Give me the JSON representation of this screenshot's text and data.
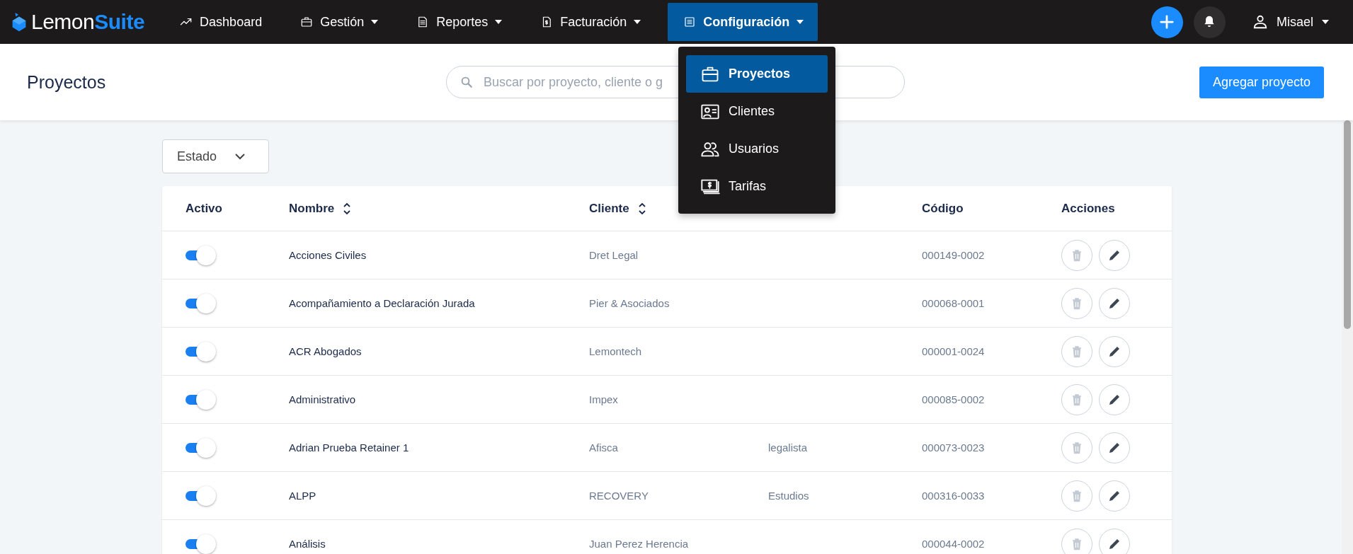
{
  "navbar": {
    "logo": {
      "first": "Lemon",
      "second": "Suite"
    },
    "items": [
      {
        "label": "Dashboard",
        "kind": "trend",
        "dropdown": false,
        "selected": false
      },
      {
        "label": "Gestión",
        "kind": "briefcase",
        "dropdown": true,
        "selected": false
      },
      {
        "label": "Reportes",
        "kind": "document",
        "dropdown": true,
        "selected": false
      },
      {
        "label": "Facturación",
        "kind": "invoice",
        "dropdown": true,
        "selected": false
      },
      {
        "label": "Configuración",
        "kind": "list",
        "dropdown": true,
        "selected": true
      }
    ],
    "user": "Misael"
  },
  "menu": {
    "items": [
      {
        "label": "Proyectos",
        "kind": "briefcase",
        "selected": true
      },
      {
        "label": "Clientes",
        "kind": "contact",
        "selected": false
      },
      {
        "label": "Usuarios",
        "kind": "users",
        "selected": false
      },
      {
        "label": "Tarifas",
        "kind": "money",
        "selected": false
      }
    ]
  },
  "header": {
    "title": "Proyectos",
    "search_placeholder": "Buscar por proyecto, cliente o g",
    "button": "Agregar proyecto"
  },
  "filter": {
    "label": "Estado"
  },
  "table": {
    "columns": [
      {
        "label": "Activo",
        "sortable": false
      },
      {
        "label": "Nombre",
        "sortable": true
      },
      {
        "label": "Cliente",
        "sortable": true
      },
      {},
      {
        "label": "Código",
        "sortable": false
      },
      {
        "label": "Acciones",
        "sortable": false
      }
    ],
    "rows": [
      {
        "active": true,
        "name": "Acciones Civiles",
        "client": "Dret Legal",
        "code": "000149-0002"
      },
      {
        "active": true,
        "name": "Acompañamiento a Declaración Jurada",
        "client": "Pier & Asociados",
        "code": "000068-0001"
      },
      {
        "active": true,
        "name": "ACR Abogados",
        "client": "Lemontech",
        "code": "000001-0024"
      },
      {
        "active": true,
        "name": "Administrativo",
        "client": "Impex",
        "code": "000085-0002"
      },
      {
        "active": true,
        "name": "Adrian Prueba Retainer 1",
        "client": "Afisca",
        "group": "legalista",
        "code": "000073-0023"
      },
      {
        "active": true,
        "name": "ALPP",
        "client": "RECOVERY",
        "group": "Estudios",
        "code": "000316-0033"
      },
      {
        "active": true,
        "name": "Análisis",
        "client": "Juan Perez Herencia",
        "code": "000044-0002"
      }
    ]
  }
}
